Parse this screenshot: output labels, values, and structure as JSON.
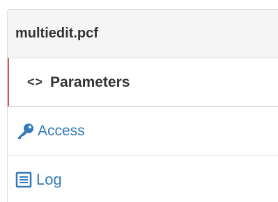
{
  "panel": {
    "title": "multiedit.pcf"
  },
  "nav": {
    "items": [
      {
        "label": "Parameters",
        "icon": "code-icon",
        "active": true
      },
      {
        "label": "Access",
        "icon": "key-icon",
        "active": false
      },
      {
        "label": "Log",
        "icon": "list-icon",
        "active": false
      }
    ]
  },
  "colors": {
    "active_border": "#d9534f",
    "link": "#337ab7",
    "heading_bg": "#f5f5f5"
  }
}
